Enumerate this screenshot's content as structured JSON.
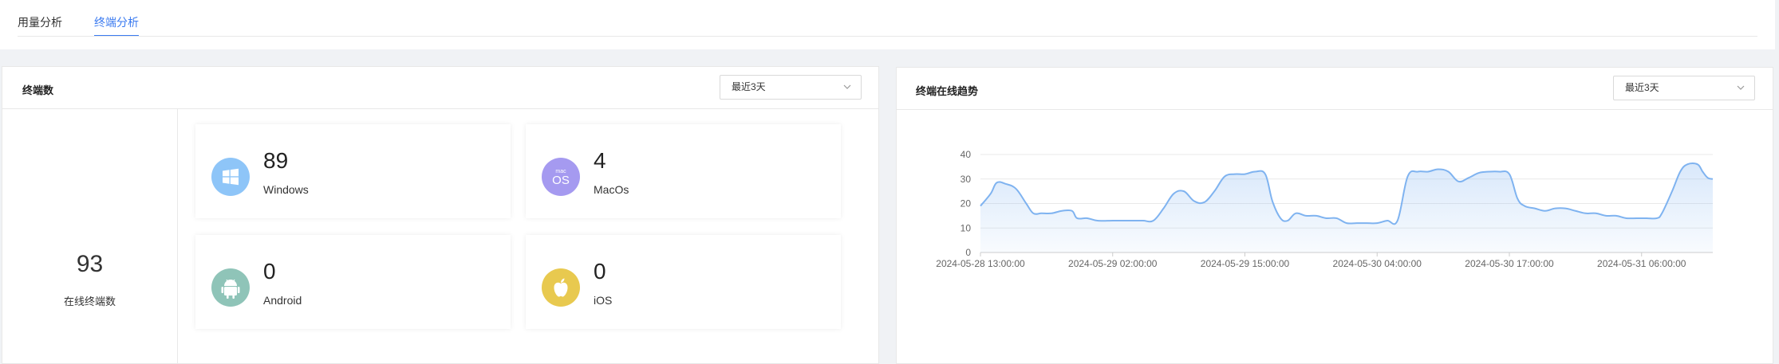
{
  "tabs": [
    {
      "label": "用量分析",
      "active": false
    },
    {
      "label": "终端分析",
      "active": true
    }
  ],
  "terminal_panel": {
    "title": "终端数",
    "range": "最近3天",
    "total": "93",
    "total_label": "在线终端数",
    "cards": [
      {
        "count": "89",
        "name": "Windows",
        "icon": "windows-icon",
        "color": "#8ec5f8"
      },
      {
        "count": "4",
        "name": "MacOs",
        "icon": "macos-icon",
        "color": "#a59af0",
        "icon_top": "mac",
        "icon_main": "OS"
      },
      {
        "count": "0",
        "name": "Android",
        "icon": "android-icon",
        "color": "#8fc4b8"
      },
      {
        "count": "0",
        "name": "iOS",
        "icon": "apple-icon",
        "color": "#e8c94f"
      }
    ]
  },
  "trend_panel": {
    "title": "终端在线趋势",
    "range": "最近3天"
  },
  "chart_data": {
    "type": "area",
    "title": "",
    "xlabel": "",
    "ylabel": "",
    "ylim": [
      0,
      40
    ],
    "yticks": [
      0,
      10,
      20,
      30,
      40
    ],
    "grid": true,
    "color": "#7fb3f0",
    "x_tick_labels": [
      "2024-05-28 13:00:00",
      "2024-05-29 02:00:00",
      "2024-05-29 15:00:00",
      "2024-05-30 04:00:00",
      "2024-05-30 17:00:00",
      "2024-05-31 06:00:00"
    ],
    "x_tick_positions": [
      0,
      13,
      26,
      39,
      52,
      65
    ],
    "x_max": 72,
    "points": [
      [
        0,
        19
      ],
      [
        1,
        24
      ],
      [
        1.6,
        28.5
      ],
      [
        2.5,
        28
      ],
      [
        3.5,
        26
      ],
      [
        4.5,
        20
      ],
      [
        5.2,
        16
      ],
      [
        6,
        16
      ],
      [
        7,
        16
      ],
      [
        8,
        17
      ],
      [
        9,
        17
      ],
      [
        9.5,
        14
      ],
      [
        10.5,
        14
      ],
      [
        11.5,
        13
      ],
      [
        13,
        13
      ],
      [
        14,
        13
      ],
      [
        15,
        13
      ],
      [
        16,
        13
      ],
      [
        17,
        13
      ],
      [
        18,
        18
      ],
      [
        19,
        24
      ],
      [
        20,
        25
      ],
      [
        21,
        21
      ],
      [
        22,
        20.5
      ],
      [
        23,
        25
      ],
      [
        24,
        31
      ],
      [
        25,
        32
      ],
      [
        26,
        32
      ],
      [
        27,
        33
      ],
      [
        28,
        32
      ],
      [
        28.7,
        21
      ],
      [
        29.5,
        14
      ],
      [
        30.2,
        13
      ],
      [
        31,
        16
      ],
      [
        32,
        15
      ],
      [
        33,
        15
      ],
      [
        34,
        14
      ],
      [
        35,
        14
      ],
      [
        36,
        12
      ],
      [
        37,
        12
      ],
      [
        38,
        12
      ],
      [
        39,
        12
      ],
      [
        40,
        13
      ],
      [
        41,
        13
      ],
      [
        42,
        31
      ],
      [
        43,
        33
      ],
      [
        44,
        33
      ],
      [
        45,
        34
      ],
      [
        46,
        33
      ],
      [
        47,
        29
      ],
      [
        48,
        30.5
      ],
      [
        49,
        32.5
      ],
      [
        50,
        33
      ],
      [
        51,
        33
      ],
      [
        52,
        32
      ],
      [
        52.8,
        22
      ],
      [
        53.5,
        19
      ],
      [
        54.5,
        18
      ],
      [
        55.5,
        17
      ],
      [
        56.5,
        18
      ],
      [
        57.5,
        18
      ],
      [
        58.5,
        17
      ],
      [
        59.5,
        16
      ],
      [
        60.5,
        16
      ],
      [
        61.5,
        15
      ],
      [
        62.5,
        15
      ],
      [
        63.5,
        14
      ],
      [
        64.5,
        14
      ],
      [
        65.5,
        14
      ],
      [
        66.5,
        14
      ],
      [
        67,
        16
      ],
      [
        68,
        25
      ],
      [
        68.8,
        33
      ],
      [
        69.5,
        36
      ],
      [
        70.5,
        36
      ],
      [
        71,
        33
      ],
      [
        71.5,
        30.5
      ],
      [
        72,
        30
      ]
    ]
  }
}
